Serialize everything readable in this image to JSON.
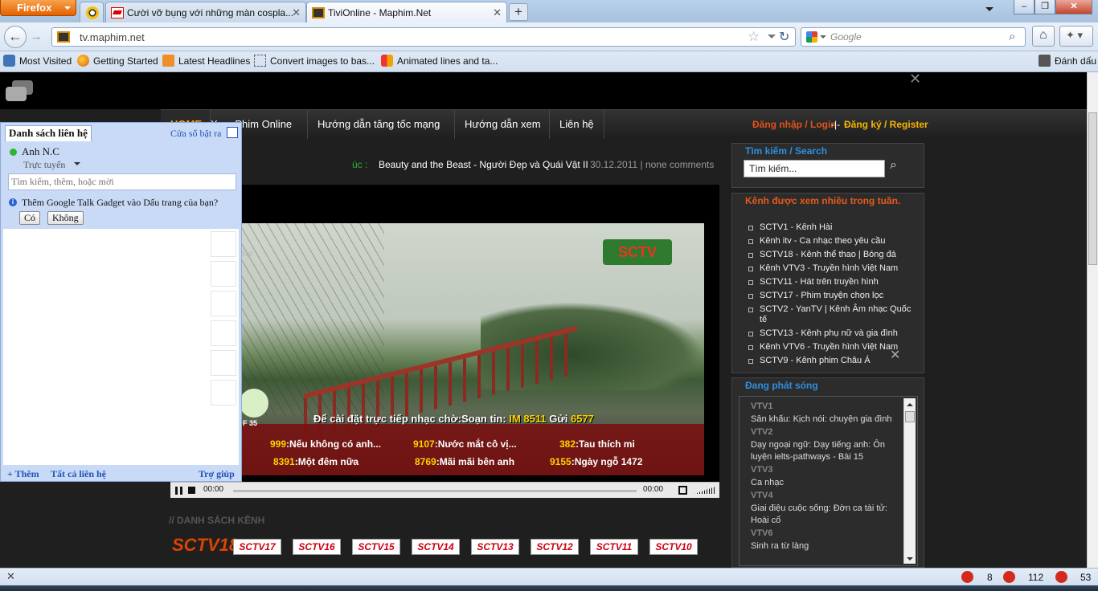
{
  "browser": {
    "menu_button": "Firefox",
    "tabs": [
      {
        "label": "Cười vỡ bụng với những màn cospla..."
      },
      {
        "label": "TiviOnline - Maphim.Net"
      }
    ],
    "new_tab": "+",
    "window_buttons": {
      "minimize": "–",
      "maximize": "❐",
      "close": "✕"
    },
    "url": "tv.maphim.net",
    "search_placeholder": "Google",
    "bookmarks": [
      {
        "label": "Most Visited"
      },
      {
        "label": "Getting Started"
      },
      {
        "label": "Latest Headlines"
      },
      {
        "label": "Convert images to bas..."
      },
      {
        "label": "Animated lines and ta..."
      },
      {
        "label": "Đánh dấu"
      }
    ]
  },
  "site": {
    "nav": [
      "HOME",
      "Xem Phim Online",
      "Hướng dẫn tăng tốc mạng",
      "Hướng dẫn xem",
      "Liên hệ"
    ],
    "login": "Đăng nhập / Login",
    "login_separator": "-|-",
    "register": "Đăng ký / Register",
    "ticker": {
      "label": "úc :",
      "title": "Beauty and the Beast - Người Đẹp và Quái Vật II",
      "date": "30.12.2011",
      "separator": "|",
      "comments": "none comments"
    },
    "player": {
      "time_elapsed": "00:00",
      "time_total": "00:00",
      "overlay": {
        "logo": "SCTV",
        "logo_left": "ntv",
        "sms_prefix": "Để cài đặt trực tiếp nhạc chờ:",
        "sms_text": "Soạn tin:",
        "sms_code": "IM 8511",
        "sms_send": "Gửi",
        "sms_number": "6577",
        "badge": "F 35",
        "songs": [
          {
            "code": "999",
            "name": "Nếu không có anh..."
          },
          {
            "code": "9107",
            "name": "Nước mắt cô vị..."
          },
          {
            "code": "382",
            "name": "Tau thích mi"
          },
          {
            "code": "8391",
            "name": "Một đêm nữa"
          },
          {
            "code": "8769",
            "name": "Mãi mãi bên anh"
          },
          {
            "code": "9155",
            "name": "Ngày ngỗ 1472"
          }
        ]
      }
    },
    "channel_list_heading": "// DANH SÁCH KÊNH",
    "channel_logos": [
      "SCTV18",
      "SCTV17",
      "SCTV16",
      "SCTV15",
      "SCTV14",
      "SCTV13",
      "SCTV12",
      "SCTV11",
      "SCTV10"
    ],
    "sidebar": {
      "search_title": "Tìm kiếm / Search",
      "search_value": "Tìm kiếm...",
      "top_title": "Kênh được xem nhiều trong tuần.",
      "top_channels": [
        "SCTV1 - Kênh Hài",
        "Kênh itv - Ca nhạc theo yêu cầu",
        "SCTV18 - Kênh thể thao | Bóng đá",
        "Kênh VTV3 - Truyền hình Việt Nam",
        "SCTV11 - Hát trên truyền hình",
        "SCTV17 - Phim truyện chọn lọc",
        "SCTV2 - YanTV | Kênh Âm nhạc Quốc tế",
        "SCTV13 - Kênh phụ nữ và gia đình",
        "Kênh VTV6 - Truyền hình Việt Nam",
        "SCTV9 - Kênh phim Châu Á"
      ],
      "live_title": "Đang phát sóng",
      "live": [
        {
          "channel": "VTV1",
          "show": "Sân khấu: Kịch nói: chuyện gia đình"
        },
        {
          "channel": "VTV2",
          "show": "Dạy ngoại ngữ: Dạy tiếng anh: Ôn luyện ielts-pathways - Bài 15"
        },
        {
          "channel": "VTV3",
          "show": "Ca nhạc"
        },
        {
          "channel": "VTV4",
          "show": "Giai điệu cuộc sống: Đờn ca tài tử: Hoài cổ"
        },
        {
          "channel": "VTV6",
          "show": "Sinh ra từ làng"
        }
      ]
    }
  },
  "gtalk": {
    "tab": "Danh sách liên hệ",
    "popout": "Cửa sổ bật ra",
    "username": "Anh N.C",
    "status": "Trực tuyến",
    "search_placeholder": "Tìm kiếm, thêm, hoặc mời",
    "prompt": "Thêm Google Talk Gadget vào Dấu trang của bạn?",
    "yes": "Có",
    "no": "Không",
    "footer_add": "+ Thêm",
    "footer_all": "Tất cả liên hệ",
    "footer_help": "Trợ giúp"
  },
  "statusbar": {
    "close": "✕",
    "counters": [
      "8",
      "112",
      "53"
    ]
  },
  "colors": {
    "menu_active": "#f7a21b",
    "login": "#e0521a",
    "register": "#f7b500",
    "widget_title_blue": "#2f8fe0",
    "widget_title_orange": "#e55a1a",
    "ticker_green": "#2db32d"
  },
  "icons": [
    "search-icon",
    "home-icon",
    "reload-icon",
    "star-icon",
    "tools-icon",
    "chat-icon",
    "popout-icon",
    "info-icon",
    "runner-icon"
  ]
}
